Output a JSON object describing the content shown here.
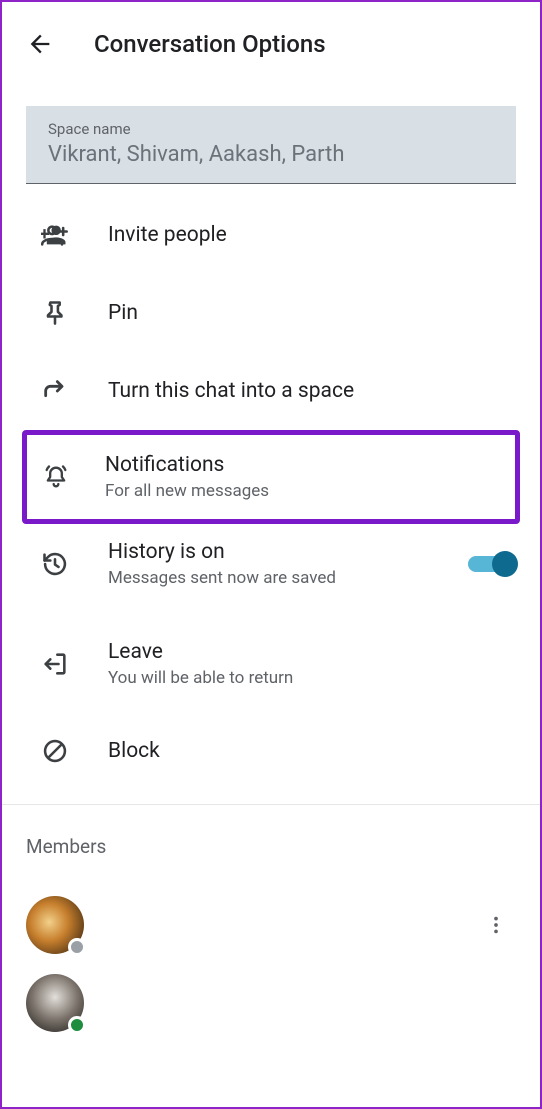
{
  "header": {
    "title": "Conversation Options"
  },
  "spaceName": {
    "label": "Space name",
    "value": "Vikrant, Shivam, Aakash, Parth"
  },
  "options": {
    "invite": {
      "label": "Invite people"
    },
    "pin": {
      "label": "Pin"
    },
    "turnIntoSpace": {
      "label": "Turn this chat into a space"
    },
    "notifications": {
      "label": "Notifications",
      "sub": "For all new messages"
    },
    "history": {
      "label": "History is on",
      "sub": "Messages sent now are saved",
      "toggle": true
    },
    "leave": {
      "label": "Leave",
      "sub": "You will be able to return"
    },
    "block": {
      "label": "Block"
    }
  },
  "members": {
    "title": "Members",
    "list": [
      {
        "status": "away"
      },
      {
        "status": "online"
      }
    ]
  },
  "colors": {
    "highlight": "#7a19c9",
    "toggleThumb": "#0f6a8f",
    "toggleTrack": "#57b5d6"
  }
}
